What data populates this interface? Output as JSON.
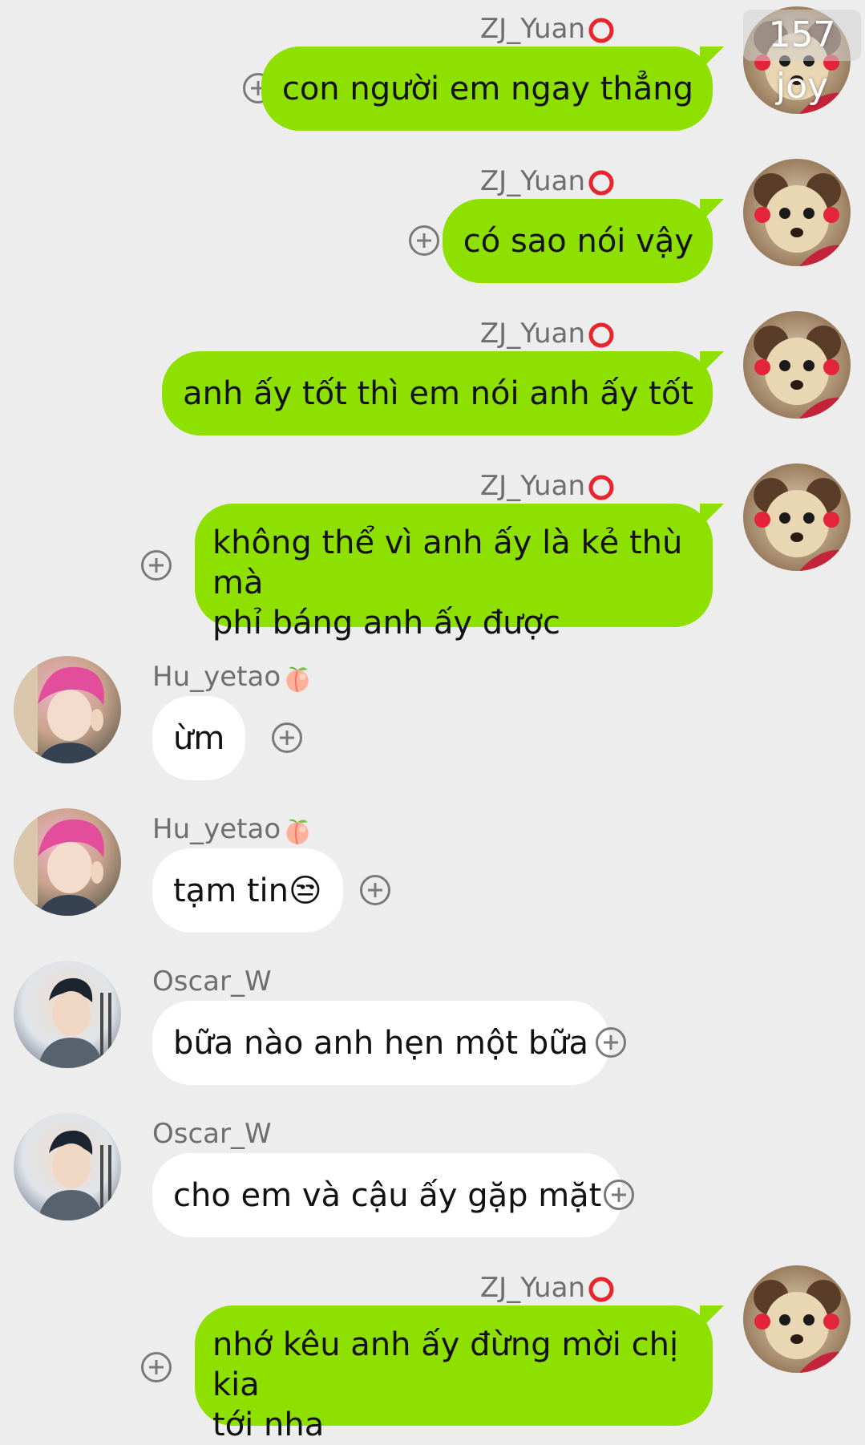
{
  "overlay_counter": "157 joy",
  "messages": [
    {
      "sender": "ZJ_Yuan",
      "badge": "red-ring",
      "text": "con người em ngay thẳng"
    },
    {
      "sender": "ZJ_Yuan",
      "badge": "red-ring",
      "text": "có sao nói vậy"
    },
    {
      "sender": "ZJ_Yuan",
      "badge": "red-ring",
      "text": "anh ấy tốt thì em nói anh ấy tốt"
    },
    {
      "sender": "ZJ_Yuan",
      "badge": "red-ring",
      "text_line1": "không thể vì anh ấy là kẻ thù mà",
      "text_line2": "phỉ báng anh ấy được"
    },
    {
      "sender": "Hu_yetao",
      "badge": "peach",
      "text": "ừm"
    },
    {
      "sender": "Hu_yetao",
      "badge": "peach",
      "text": "tạm tin",
      "emoji": "😒"
    },
    {
      "sender": "Oscar_W",
      "text": "bữa nào anh hẹn một bữa"
    },
    {
      "sender": "Oscar_W",
      "text": "cho em và cậu ấy gặp mặt"
    },
    {
      "sender": "ZJ_Yuan",
      "badge": "red-ring",
      "text_line1": "nhớ kêu anh ấy đừng mời chị kia",
      "text_line2": "tới nha"
    }
  ],
  "icons": {
    "add": "plus-circle-icon",
    "ring": "red-ring-icon",
    "peach": "peach-icon"
  },
  "colors": {
    "background": "#ededed",
    "own_bubble": "#8ee000",
    "other_bubble": "#ffffff",
    "name_text": "#6e6e6e"
  }
}
